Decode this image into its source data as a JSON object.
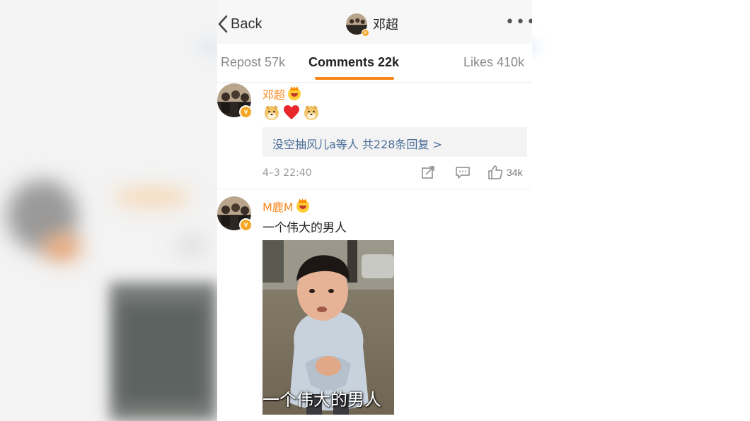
{
  "header": {
    "back_label": "Back",
    "user_name": "邓超",
    "more_icon": "more-dots-icon"
  },
  "tabs": [
    {
      "label": "Repost 57k",
      "active": false
    },
    {
      "label": "Comments 22k",
      "active": true
    },
    {
      "label": "Likes 410k",
      "active": false
    }
  ],
  "colors": {
    "accent": "#f7871b",
    "link": "#4a6d98",
    "verified": "#f5a623"
  },
  "comments": [
    {
      "author": "邓超",
      "badge_icon": "crown-emoji-icon",
      "verified_mark": "v",
      "content_emojis": [
        "doge-emoji-icon",
        "heart-emoji-icon",
        "doge-emoji-icon"
      ],
      "replies_link": "没空抽风儿a等人  共228条回复 >",
      "time": "4–3 22:40",
      "likes": "34k"
    },
    {
      "author": "M鹿M",
      "badge_icon": "crown-emoji-icon",
      "verified_mark": "v",
      "text": "一个伟大的男人",
      "image_caption": "一个伟大的男人"
    }
  ]
}
